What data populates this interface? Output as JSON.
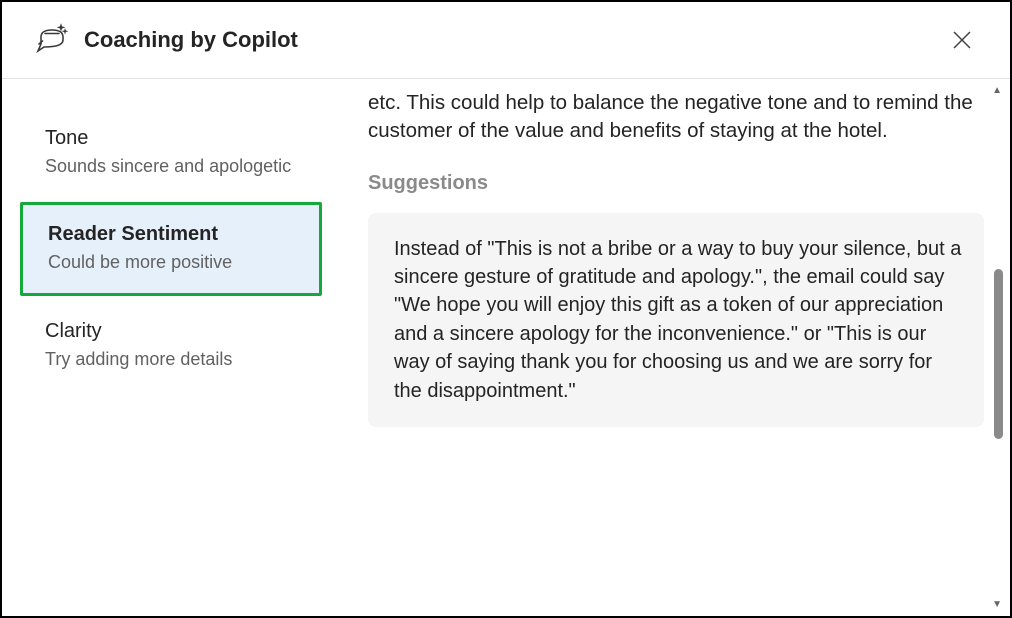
{
  "header": {
    "title": "Coaching by Copilot"
  },
  "sidebar": {
    "items": [
      {
        "title": "Tone",
        "subtitle": "Sounds sincere and apologetic",
        "selected": false
      },
      {
        "title": "Reader Sentiment",
        "subtitle": "Could be more positive",
        "selected": true
      },
      {
        "title": "Clarity",
        "subtitle": "Try adding more details",
        "selected": false
      }
    ]
  },
  "main": {
    "body_text": "etc. This could help to balance the negative tone and to remind the customer of the value and benefits of staying at the hotel.",
    "suggestions_label": "Suggestions",
    "suggestion_text": "Instead of \"This is not a bribe or a way to buy your silence, but a sincere gesture of gratitude and apology.\", the email could say \"We hope you will enjoy this gift as a token of our appreciation and a sincere apology for the inconvenience.\" or \"This is our way of saying thank you for choosing us and we are sorry for the disappointment.\""
  }
}
